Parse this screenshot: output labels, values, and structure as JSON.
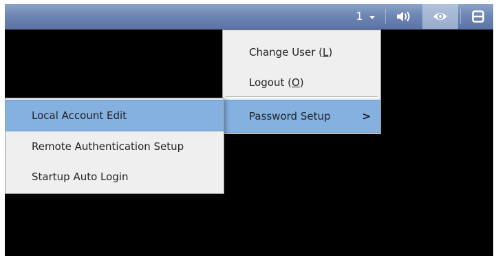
{
  "toolbar": {
    "channel_number": "1",
    "icons": {
      "caret": "chevron-down-icon",
      "volume": "speaker-volume-icon",
      "view": "eye-icon",
      "layout": "split-layout-icon"
    }
  },
  "main_menu": {
    "change_user_label": "Change User",
    "change_user_key": "L",
    "logout_label": "Logout",
    "logout_key": "O",
    "password_setup_label": "Password Setup",
    "password_setup_arrow": ">"
  },
  "password_submenu": {
    "items": [
      {
        "label": "Local Account Edit"
      },
      {
        "label": "Remote Authentication Setup"
      },
      {
        "label": "Startup Auto Login"
      }
    ]
  },
  "colors": {
    "toolbar_bg": "#6e86b4",
    "menu_bg": "#efefef",
    "highlight": "#84b1e0",
    "screen_bg": "#000000"
  }
}
